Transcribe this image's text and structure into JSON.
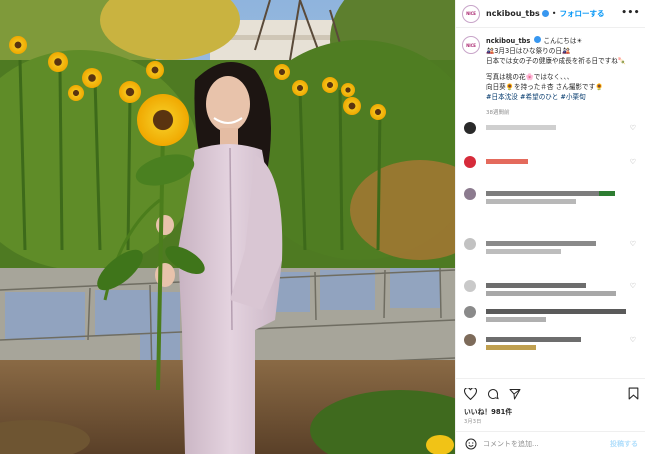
{
  "post": {
    "username": "nckibou_tbs",
    "avatar_text": "NICE",
    "follow_label": "フォローする",
    "more_label": "•••",
    "dot": "•"
  },
  "caption": {
    "username": "nckibou_tbs",
    "line1": "こんにちは☀",
    "line2": "🎎3月3日はひな祭りの日🎎",
    "line3": "日本では女の子の健康や成長を祈る日ですね🍡",
    "line4": "写真は桃の花🌸ではなく、、、",
    "line5": "向日葵🌻を持った＃杏 さん撮影です🌻",
    "hashtags": "#日本沈没 #希望のひと #小栗旬",
    "time": "38週間前"
  },
  "comments": [
    {
      "avatar_color": "#2a2a2a",
      "bar_color": "#c7c7c7"
    },
    {
      "avatar_color": "#d62b3a",
      "bar_color": "#e46a5c"
    },
    {
      "avatar_color": "#8c7b8f",
      "bar_color": "#6d6d6d"
    },
    {
      "avatar_color": "#bdbdbd",
      "bar_color": "#8a8a8a"
    },
    {
      "avatar_color": "#c9c9c9",
      "bar_color": "#6d6d6d"
    },
    {
      "avatar_color": "#8a8a8a",
      "bar_color": "#5a5a5a"
    },
    {
      "avatar_color": "#cfcfcf",
      "bar_color": "#9a9a9a"
    },
    {
      "avatar_color": "#7d6b5a",
      "bar_color": "#6d6d6d"
    }
  ],
  "actions": {
    "heart_icon": "heart-icon",
    "comment_icon": "comment-icon",
    "share_icon": "share-icon",
    "bookmark_icon": "bookmark-icon",
    "likes": "いいね！981件",
    "date": "3月3日"
  },
  "add_comment": {
    "placeholder": "コメントを追加...",
    "post_label": "投稿する",
    "emoji_icon": "emoji-icon"
  },
  "colors": {
    "accent": "#0095f6",
    "verified": "#3897f0",
    "hashtag": "#00376b"
  }
}
